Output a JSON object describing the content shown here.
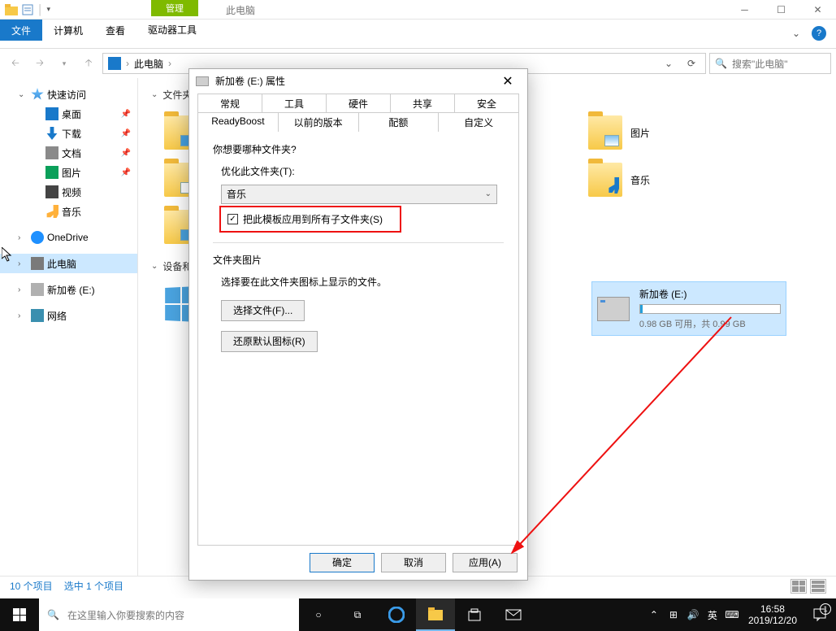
{
  "window": {
    "context_tab_header": "管理",
    "title": "此电脑"
  },
  "ribbon": {
    "file": "文件",
    "tabs": [
      "计算机",
      "查看"
    ],
    "context_tab": "驱动器工具"
  },
  "addressbar": {
    "location": "此电脑",
    "sep": "›"
  },
  "search": {
    "placeholder": "搜索\"此电脑\""
  },
  "sidebar": {
    "quick_access": "快速访问",
    "items_qa": [
      {
        "label": "桌面",
        "icon": "icon-desktop",
        "pin": true
      },
      {
        "label": "下载",
        "icon": "icon-download",
        "pin": true
      },
      {
        "label": "文档",
        "icon": "icon-doc",
        "pin": true
      },
      {
        "label": "图片",
        "icon": "icon-pic",
        "pin": true
      },
      {
        "label": "视频",
        "icon": "icon-video"
      },
      {
        "label": "音乐",
        "icon": "icon-music"
      }
    ],
    "onedrive": "OneDrive",
    "this_pc": "此电脑",
    "drive_e": "新加卷 (E:)",
    "network": "网络"
  },
  "content": {
    "section_folders": "文件夹",
    "section_devices": "设备和",
    "folders_visible": [
      {
        "label": "图片",
        "overlay": "pic"
      },
      {
        "label": "音乐",
        "overlay": "music"
      }
    ],
    "drive": {
      "name": "新加卷 (E:)",
      "free_text": "0.98 GB 可用，共 0.99 GB"
    }
  },
  "statusbar": {
    "items": "10 个项目",
    "selected": "选中 1 个项目"
  },
  "dialog": {
    "title": "新加卷 (E:) 属性",
    "tabs_row1": [
      "常规",
      "工具",
      "硬件",
      "共享",
      "安全"
    ],
    "tabs_row2": [
      "ReadyBoost",
      "以前的版本",
      "配额",
      "自定义"
    ],
    "active_tab": "自定义",
    "q_label": "你想要哪种文件夹?",
    "optimize_label": "优化此文件夹(T):",
    "combo_value": "音乐",
    "checkbox_label": "把此模板应用到所有子文件夹(S)",
    "checkbox_checked": true,
    "pic_section": "文件夹图片",
    "pic_desc": "选择要在此文件夹图标上显示的文件。",
    "choose_file": "选择文件(F)...",
    "restore_icon": "还原默认图标(R)",
    "ok": "确定",
    "cancel": "取消",
    "apply": "应用(A)"
  },
  "taskbar": {
    "search_placeholder": "在这里输入你要搜索的内容",
    "ime": "英",
    "time": "16:58",
    "date": "2019/12/20",
    "notif_count": "1"
  }
}
